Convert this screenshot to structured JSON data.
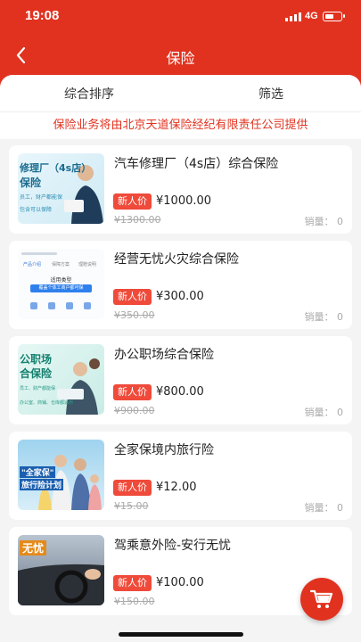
{
  "status_bar": {
    "time": "19:08",
    "network": "4G"
  },
  "nav": {
    "title": "保险"
  },
  "tabs": {
    "sort": "综合排序",
    "filter": "筛选"
  },
  "notice": "保险业务将由北京天道保险经纪有限责任公司提供",
  "products": [
    {
      "name": "汽车修理厂（4s店）综合保险",
      "badge": "新人价",
      "price": "¥1000.00",
      "original_price": "¥1300.00",
      "sales": "销量： 0",
      "thumb_text": [
        "修理厂（4s店）",
        "保险",
        "员工，财产都能保",
        "包含可以保障"
      ]
    },
    {
      "name": "经营无忧火灾综合保险",
      "badge": "新人价",
      "price": "¥300.00",
      "original_price": "¥350.00",
      "sales": "销量： 0",
      "thumb_text": [
        "产品介绍",
        "保障方案",
        "理赔说明",
        "适用类型",
        "覆盖个体工商户都可保"
      ]
    },
    {
      "name": "办公职场综合保险",
      "badge": "新人价",
      "price": "¥800.00",
      "original_price": "¥900.00",
      "sales": "销量： 0",
      "thumb_text": [
        "公职场",
        "合保险",
        "员工、财产都能保",
        "办公室、商铺、仓库都适用"
      ]
    },
    {
      "name": "全家保境内旅行险",
      "badge": "新人价",
      "price": "¥12.00",
      "original_price": "¥15.00",
      "sales": "销量： 0",
      "thumb_text": [
        "\"全家保\"",
        "旅行险计划"
      ]
    },
    {
      "name": "驾乘意外险-安行无忧",
      "badge": "新人价",
      "price": "¥100.00",
      "original_price": "¥150.00",
      "sales": "",
      "thumb_text": [
        "无忧"
      ]
    }
  ],
  "colors": {
    "primary": "#e1321f",
    "badge": "#ef4a3a"
  },
  "icons": {
    "back": "chevron-left-icon",
    "cart": "shopping-cart-icon"
  }
}
